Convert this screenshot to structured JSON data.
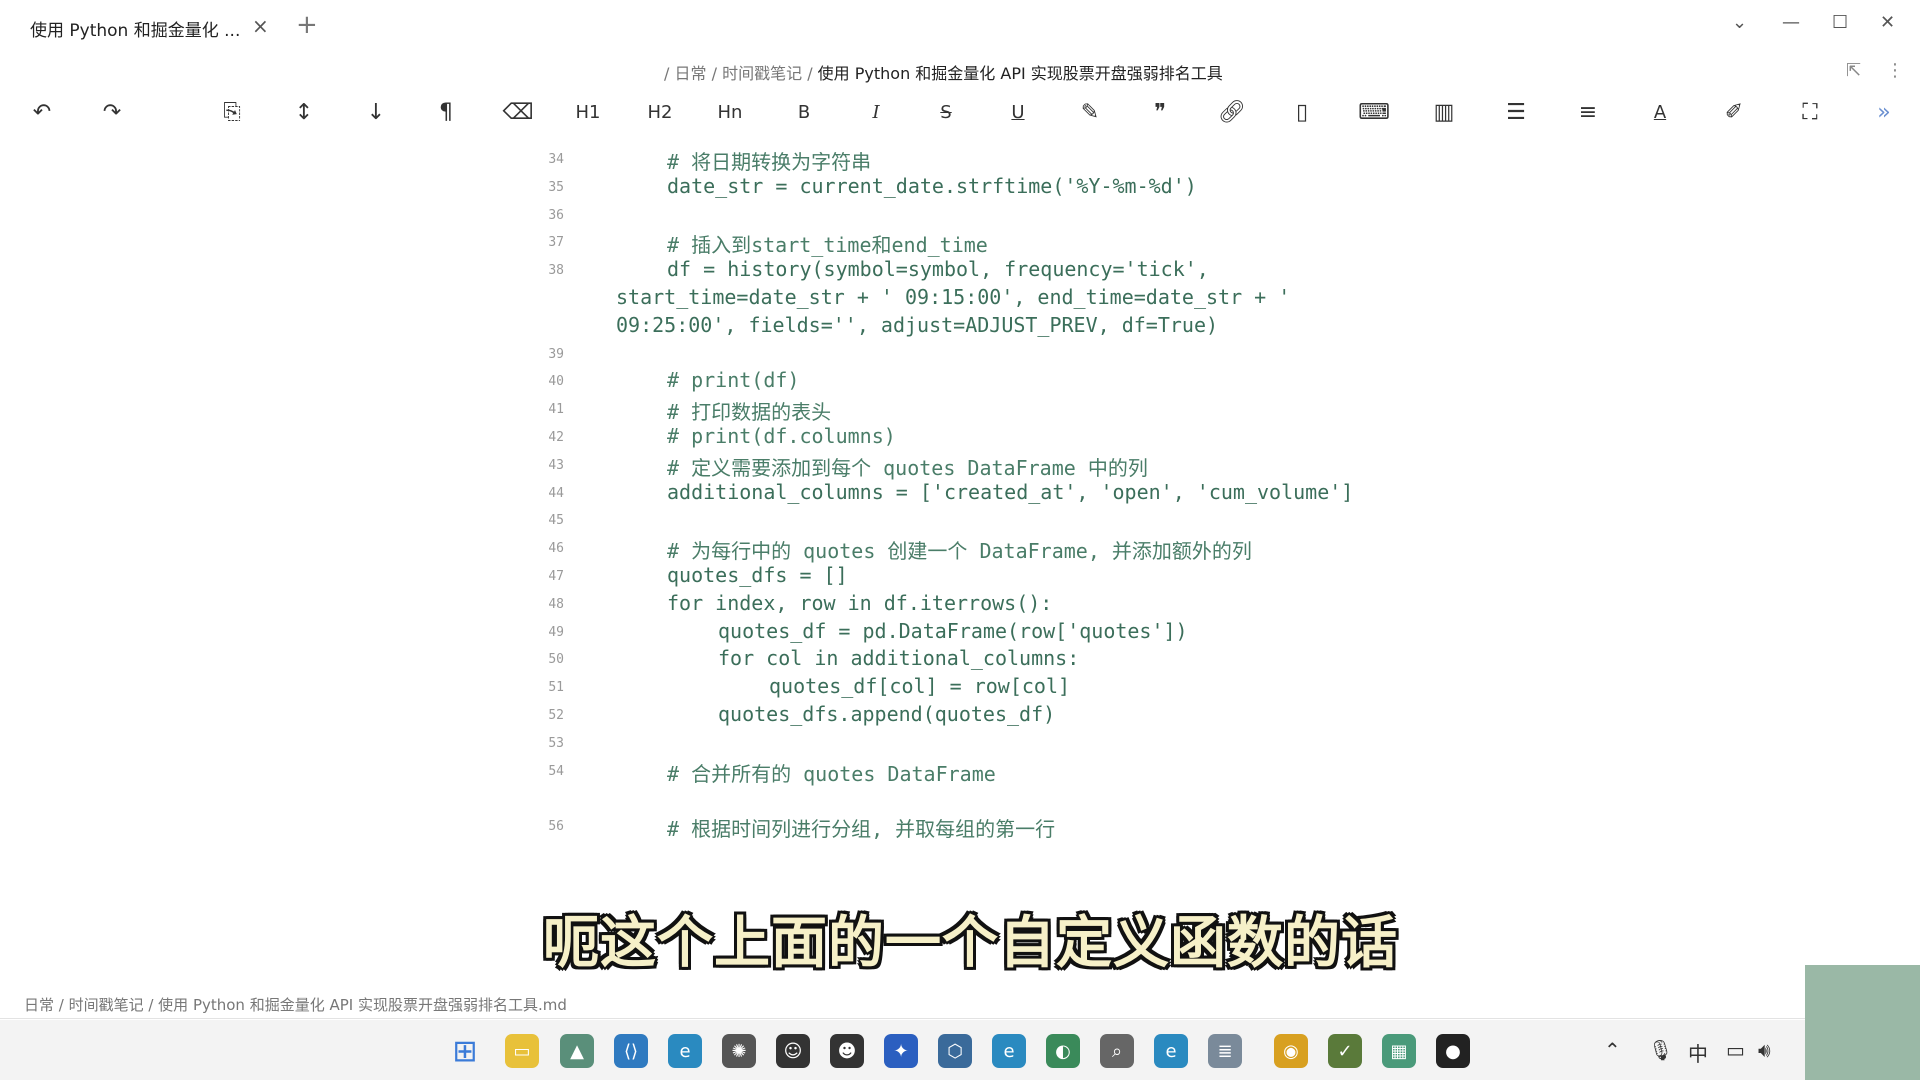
{
  "tab": {
    "title": "使用 Python 和掘金量化 ...",
    "close": "×",
    "add": "+"
  },
  "window": {
    "minimize": "⌄",
    "min2": "—",
    "max": "☐",
    "close": "✕"
  },
  "breadcrumb": {
    "sep": "/",
    "p1": "日常",
    "p2": "时间戳笔记",
    "current": "使用 Python 和掘金量化 API 实现股票开盘强弱排名工具"
  },
  "toolbar": {
    "h1": "H1",
    "h2": "H2",
    "hn": "Hn",
    "bold": "B",
    "italic": "I",
    "strike": "S",
    "underline": "U",
    "font_color": "A"
  },
  "lines": [
    {
      "n": "34",
      "text": "# 将日期转换为字符串",
      "indent": 1,
      "comment": true
    },
    {
      "n": "35",
      "text": "date_str = current_date.strftime('%Y-%m-%d')",
      "indent": 1
    },
    {
      "n": "36",
      "text": "",
      "indent": 1
    },
    {
      "n": "37",
      "text": "# 插入到start_time和end_time",
      "indent": 1,
      "comment": true
    },
    {
      "n": "38",
      "text": "df = history(symbol=symbol, frequency='tick',",
      "indent": 1
    },
    {
      "n": "",
      "text": "start_time=date_str + ' 09:15:00', end_time=date_str + '",
      "indent": 0
    },
    {
      "n": "",
      "text": "09:25:00', fields='', adjust=ADJUST_PREV, df=True)",
      "indent": 0
    },
    {
      "n": "39",
      "text": "",
      "indent": 1
    },
    {
      "n": "40",
      "text": "# print(df)",
      "indent": 1,
      "comment": true
    },
    {
      "n": "41",
      "text": "# 打印数据的表头",
      "indent": 1,
      "comment": true
    },
    {
      "n": "42",
      "text": "# print(df.columns)",
      "indent": 1,
      "comment": true
    },
    {
      "n": "43",
      "text": "# 定义需要添加到每个 quotes DataFrame 中的列",
      "indent": 1,
      "comment": true
    },
    {
      "n": "44",
      "text": "additional_columns = ['created_at', 'open', 'cum_volume']",
      "indent": 1
    },
    {
      "n": "45",
      "text": "",
      "indent": 1
    },
    {
      "n": "46",
      "text": "# 为每行中的 quotes 创建一个 DataFrame, 并添加额外的列",
      "indent": 1,
      "comment": true
    },
    {
      "n": "47",
      "text": "quotes_dfs = []",
      "indent": 1
    },
    {
      "n": "48",
      "text": "for index, row in df.iterrows():",
      "indent": 1
    },
    {
      "n": "49",
      "text": "quotes_df = pd.DataFrame(row['quotes'])",
      "indent": 2
    },
    {
      "n": "50",
      "text": "for col in additional_columns:",
      "indent": 2
    },
    {
      "n": "51",
      "text": "quotes_df[col] = row[col]",
      "indent": 3
    },
    {
      "n": "52",
      "text": "quotes_dfs.append(quotes_df)",
      "indent": 2
    },
    {
      "n": "53",
      "text": "",
      "indent": 1
    },
    {
      "n": "54",
      "text": "# 合并所有的 quotes DataFrame",
      "indent": 1,
      "comment": true
    },
    {
      "n": "",
      "text": "",
      "indent": 1
    },
    {
      "n": "56",
      "text": "# 根据时间列进行分组, 并取每组的第一行",
      "indent": 1,
      "comment": true
    }
  ],
  "subtitle": "呃这个上面的一个自定义函数的话",
  "status": "日常 / 时间戳笔记 / 使用 Python 和掘金量化 API 实现股票开盘强弱排名工具.md",
  "tray": {
    "ime": "中"
  }
}
